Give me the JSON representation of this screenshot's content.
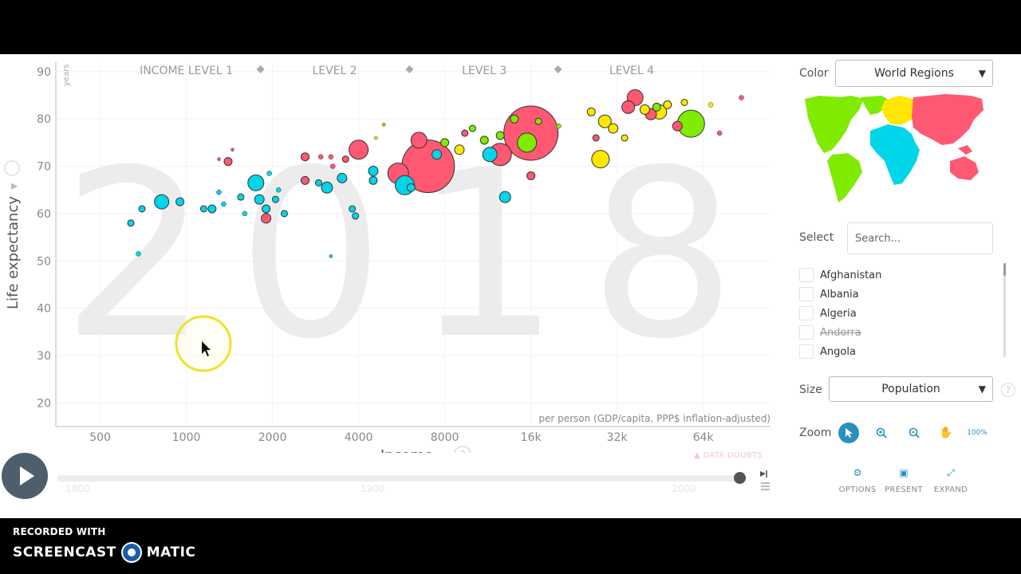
{
  "recording": {
    "line1": "RECORDED WITH",
    "brand_left": "SCREENCAST",
    "brand_right": "MATIC"
  },
  "chart_data": {
    "type": "scatter",
    "year": "2018",
    "x_scale": "log",
    "xlim": [
      350,
      110000
    ],
    "ylim": [
      15,
      92
    ],
    "xlabel": "Income",
    "x_sublabel": "per person (GDP/capita, PPP$ inflation-adjusted)",
    "ylabel": "Life expectancy",
    "y_unit": "years",
    "x_ticks": [
      500,
      1000,
      2000,
      4000,
      8000,
      16000,
      32000,
      64000
    ],
    "x_tick_labels": [
      "500",
      "1000",
      "2000",
      "4000",
      "8000",
      "16k",
      "32k",
      "64k"
    ],
    "y_ticks": [
      20,
      30,
      40,
      50,
      60,
      70,
      80,
      90
    ],
    "income_levels": [
      {
        "label": "INCOME LEVEL 1",
        "x": 1000
      },
      {
        "label": "LEVEL 2",
        "x": 3300
      },
      {
        "label": "LEVEL 3",
        "x": 11000
      },
      {
        "label": "LEVEL 4",
        "x": 36000
      }
    ],
    "colors": {
      "africa": "#00d5e9",
      "asia": "#ff5872",
      "americas": "#7feb00",
      "europe": "#ffe700"
    },
    "points": [
      {
        "x": 820,
        "y": 62.5,
        "r": 9,
        "region": "africa"
      },
      {
        "x": 640,
        "y": 58,
        "r": 4,
        "region": "africa"
      },
      {
        "x": 680,
        "y": 51.5,
        "r": 3,
        "region": "africa"
      },
      {
        "x": 700,
        "y": 61,
        "r": 4,
        "region": "africa"
      },
      {
        "x": 950,
        "y": 62.5,
        "r": 5,
        "region": "africa"
      },
      {
        "x": 1150,
        "y": 61,
        "r": 4,
        "region": "africa"
      },
      {
        "x": 1230,
        "y": 61,
        "r": 5,
        "region": "africa"
      },
      {
        "x": 1300,
        "y": 64.5,
        "r": 3,
        "region": "africa"
      },
      {
        "x": 1350,
        "y": 62,
        "r": 3,
        "region": "africa"
      },
      {
        "x": 1550,
        "y": 63.5,
        "r": 4,
        "region": "africa"
      },
      {
        "x": 1600,
        "y": 60,
        "r": 3,
        "region": "africa"
      },
      {
        "x": 1750,
        "y": 66.5,
        "r": 10,
        "region": "africa"
      },
      {
        "x": 1800,
        "y": 63,
        "r": 6,
        "region": "africa"
      },
      {
        "x": 1900,
        "y": 61,
        "r": 5,
        "region": "africa"
      },
      {
        "x": 1950,
        "y": 68.5,
        "r": 3,
        "region": "africa"
      },
      {
        "x": 2050,
        "y": 63,
        "r": 4,
        "region": "africa"
      },
      {
        "x": 2100,
        "y": 65,
        "r": 3,
        "region": "africa"
      },
      {
        "x": 2200,
        "y": 60,
        "r": 4,
        "region": "africa"
      },
      {
        "x": 3100,
        "y": 65.5,
        "r": 7,
        "region": "africa"
      },
      {
        "x": 3500,
        "y": 67.5,
        "r": 6,
        "region": "africa"
      },
      {
        "x": 3800,
        "y": 61,
        "r": 4,
        "region": "africa"
      },
      {
        "x": 3900,
        "y": 59.5,
        "r": 4,
        "region": "africa"
      },
      {
        "x": 2900,
        "y": 66.5,
        "r": 4,
        "region": "africa"
      },
      {
        "x": 4500,
        "y": 69,
        "r": 6,
        "region": "africa"
      },
      {
        "x": 4500,
        "y": 67,
        "r": 5,
        "region": "africa"
      },
      {
        "x": 5800,
        "y": 66,
        "r": 12,
        "region": "africa"
      },
      {
        "x": 6100,
        "y": 65.5,
        "r": 5,
        "region": "africa"
      },
      {
        "x": 7500,
        "y": 72.5,
        "r": 6,
        "region": "africa"
      },
      {
        "x": 11500,
        "y": 72.5,
        "r": 9,
        "region": "africa"
      },
      {
        "x": 13000,
        "y": 63.5,
        "r": 7,
        "region": "africa"
      },
      {
        "x": 3200,
        "y": 51,
        "r": 2,
        "region": "africa"
      },
      {
        "x": 1300,
        "y": 71.5,
        "r": 2,
        "region": "asia"
      },
      {
        "x": 1450,
        "y": 73.5,
        "r": 2,
        "region": "asia"
      },
      {
        "x": 1400,
        "y": 71,
        "r": 5,
        "region": "asia"
      },
      {
        "x": 1900,
        "y": 59,
        "r": 6,
        "region": "asia"
      },
      {
        "x": 2600,
        "y": 72,
        "r": 5,
        "region": "asia"
      },
      {
        "x": 2950,
        "y": 72,
        "r": 3,
        "region": "asia"
      },
      {
        "x": 3200,
        "y": 72,
        "r": 3,
        "region": "asia"
      },
      {
        "x": 3600,
        "y": 71.5,
        "r": 4,
        "region": "asia"
      },
      {
        "x": 2600,
        "y": 67,
        "r": 5,
        "region": "asia"
      },
      {
        "x": 3250,
        "y": 70,
        "r": 3,
        "region": "asia"
      },
      {
        "x": 4000,
        "y": 73.5,
        "r": 12,
        "region": "asia"
      },
      {
        "x": 5500,
        "y": 68.5,
        "r": 13,
        "region": "asia"
      },
      {
        "x": 6500,
        "y": 75.5,
        "r": 10,
        "region": "asia"
      },
      {
        "x": 7000,
        "y": 70,
        "r": 33,
        "region": "asia"
      },
      {
        "x": 9400,
        "y": 77,
        "r": 4,
        "region": "asia"
      },
      {
        "x": 12500,
        "y": 72.5,
        "r": 14,
        "region": "asia"
      },
      {
        "x": 16000,
        "y": 77,
        "r": 34,
        "region": "asia"
      },
      {
        "x": 16000,
        "y": 68,
        "r": 5,
        "region": "asia"
      },
      {
        "x": 27000,
        "y": 76,
        "r": 4,
        "region": "asia"
      },
      {
        "x": 35000,
        "y": 82.5,
        "r": 8,
        "region": "asia"
      },
      {
        "x": 37000,
        "y": 84.5,
        "r": 10,
        "region": "asia"
      },
      {
        "x": 42000,
        "y": 81,
        "r": 7,
        "region": "asia"
      },
      {
        "x": 52000,
        "y": 78.5,
        "r": 6,
        "region": "asia"
      },
      {
        "x": 73000,
        "y": 77,
        "r": 3,
        "region": "asia"
      },
      {
        "x": 87000,
        "y": 84.5,
        "r": 3,
        "region": "asia"
      },
      {
        "x": 4900,
        "y": 78.8,
        "r": 2,
        "region": "americas"
      },
      {
        "x": 8000,
        "y": 75,
        "r": 5,
        "region": "americas"
      },
      {
        "x": 10000,
        "y": 78,
        "r": 4,
        "region": "americas"
      },
      {
        "x": 11000,
        "y": 75.5,
        "r": 5,
        "region": "americas"
      },
      {
        "x": 12500,
        "y": 76.5,
        "r": 5,
        "region": "americas"
      },
      {
        "x": 14000,
        "y": 80,
        "r": 5,
        "region": "americas"
      },
      {
        "x": 15500,
        "y": 75,
        "r": 12,
        "region": "americas"
      },
      {
        "x": 17000,
        "y": 79.5,
        "r": 4,
        "region": "americas"
      },
      {
        "x": 20000,
        "y": 78.5,
        "r": 3,
        "region": "americas"
      },
      {
        "x": 58000,
        "y": 79,
        "r": 17,
        "region": "americas"
      },
      {
        "x": 44000,
        "y": 82.5,
        "r": 5,
        "region": "americas"
      },
      {
        "x": 4600,
        "y": 76,
        "r": 2,
        "region": "europe"
      },
      {
        "x": 9000,
        "y": 73.5,
        "r": 6,
        "region": "europe"
      },
      {
        "x": 26000,
        "y": 81.5,
        "r": 5,
        "region": "europe"
      },
      {
        "x": 29000,
        "y": 79.5,
        "r": 8,
        "region": "europe"
      },
      {
        "x": 31000,
        "y": 78,
        "r": 6,
        "region": "europe"
      },
      {
        "x": 34000,
        "y": 76,
        "r": 4,
        "region": "europe"
      },
      {
        "x": 28000,
        "y": 71.5,
        "r": 11,
        "region": "europe"
      },
      {
        "x": 40000,
        "y": 82,
        "r": 6,
        "region": "europe"
      },
      {
        "x": 45000,
        "y": 81.5,
        "r": 9,
        "region": "europe"
      },
      {
        "x": 48000,
        "y": 83,
        "r": 5,
        "region": "europe"
      },
      {
        "x": 55000,
        "y": 83.5,
        "r": 4,
        "region": "europe"
      },
      {
        "x": 68000,
        "y": 83,
        "r": 3,
        "region": "europe"
      }
    ]
  },
  "panel": {
    "color_label": "Color",
    "color_value": "World Regions",
    "select_label": "Select",
    "search_placeholder": "Search...",
    "countries": [
      {
        "name": "Afghanistan",
        "disabled": false
      },
      {
        "name": "Albania",
        "disabled": false
      },
      {
        "name": "Algeria",
        "disabled": false
      },
      {
        "name": "Andorra",
        "disabled": true
      },
      {
        "name": "Angola",
        "disabled": false
      }
    ],
    "size_label": "Size",
    "size_value": "Population",
    "zoom_label": "Zoom",
    "zoom_percent": "100%",
    "tools": [
      "OPTIONS",
      "PRESENT",
      "EXPAND"
    ]
  },
  "timeline": {
    "labels": [
      "1800",
      "1900",
      "2000"
    ],
    "current_year": "2018",
    "warning": "DATA DOUBTS"
  }
}
